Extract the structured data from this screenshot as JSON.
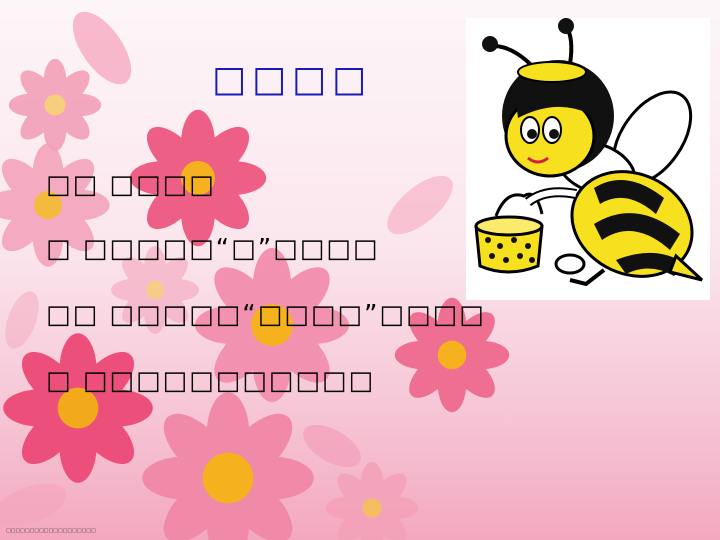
{
  "slide": {
    "title": "□□□□",
    "lines": [
      "□□ □□□□",
      "□ □□□□□“□”□□□□",
      "□□ □□□□□“□□□□”□□□□",
      "□ □□□□□□□□□□□"
    ],
    "footer": "□□□□□□□□□□□□□□□□□□□"
  },
  "colors": {
    "title": "#1a1ab8",
    "text": "#000000",
    "flower_petal": "#f07a9c",
    "flower_center": "#f5b21e",
    "bee_yellow": "#f7e11e"
  },
  "icons": [
    "bee-with-honey-pot-illustration",
    "pink-cosmos-flower"
  ]
}
